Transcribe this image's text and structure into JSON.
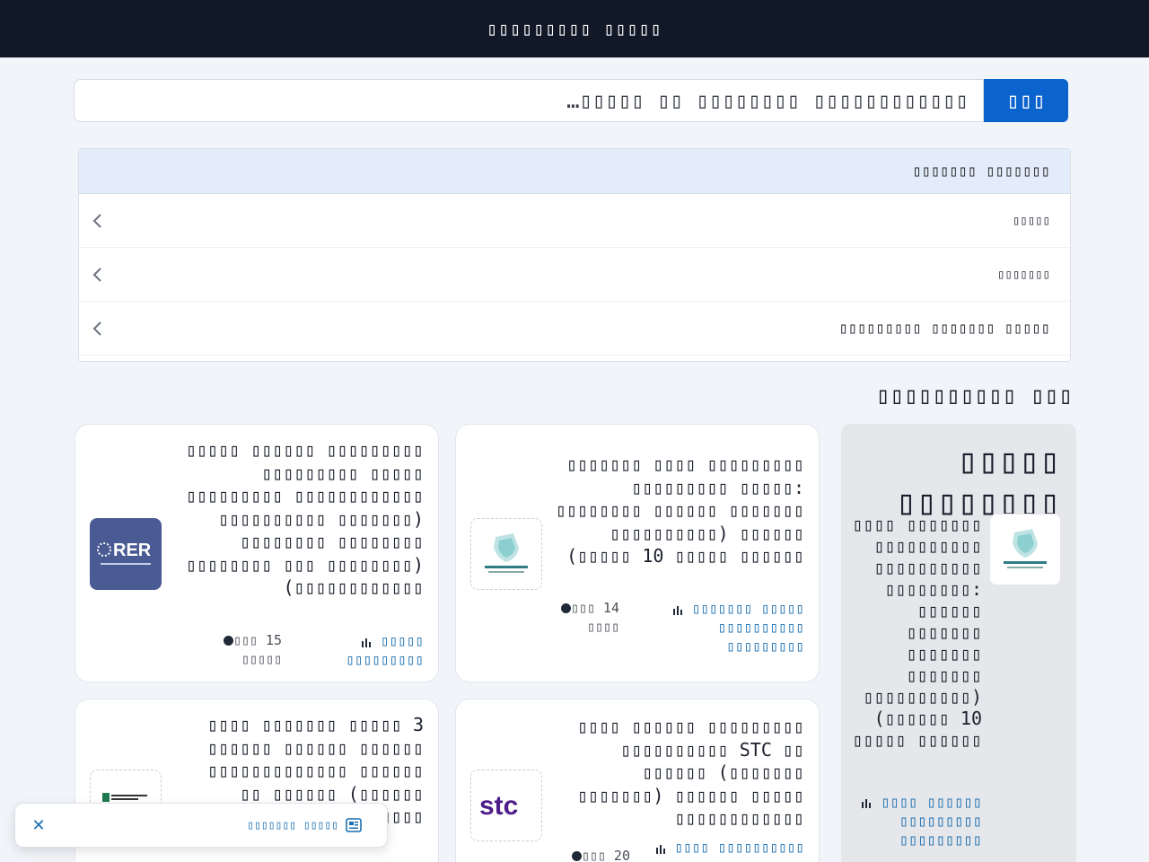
{
  "header": {
    "title": "▯▯▯▯▯▯▯▯▯ ▯▯▯▯▯"
  },
  "search": {
    "placeholder": "▯▯▯▯▯▯▯▯▯▯▯▯ ▯▯▯▯▯▯▯▯ ▯▯ ▯▯▯▯▯…",
    "button_label": "▯▯▯"
  },
  "categories": {
    "header": "▯▯▯▯▯▯▯ ▯▯▯▯▯▯▯",
    "items": [
      {
        "label": "▯▯▯▯▯"
      },
      {
        "label": "▯▯▯▯▯▯▯"
      },
      {
        "label": "▯▯▯▯▯▯▯▯▯ ▯▯▯▯▯▯▯ ▯▯▯▯▯"
      }
    ]
  },
  "section": {
    "title": "▯▯▯▯▯▯▯▯▯▯ ▯▯▯"
  },
  "sidebar": {
    "heading": "▯▯▯▯▯ ▯▯▯▯▯▯▯▯",
    "text": "▯▯▯▯ ▯▯▯▯▯▯▯ ▯▯▯▯▯▯▯▯▯▯ ▯▯▯▯▯▯▯▯▯▯ ▯▯▯▯▯▯▯▯: ▯▯▯▯▯▯ ▯▯▯▯▯▯▯ ▯▯▯▯▯▯▯ ▯▯▯▯▯▯▯ ▯▯▯▯▯▯▯▯▯▯) (▯▯▯▯▯▯ 10 ▯▯▯▯▯ ▯▯▯▯▯▯",
    "link": "▯▯▯▯ ▯▯▯▯▯▯ ▯▯▯▯▯▯▯▯▯ ▯▯▯▯▯▯▯▯▯"
  },
  "cards": [
    {
      "title": "▯▯▯▯▯▯▯ ▯▯▯▯ ▯▯▯▯▯▯▯▯▯ ▯▯▯▯▯▯▯▯▯ ▯▯▯▯▯: ▯▯▯▯▯▯▯▯ ▯▯▯▯▯▯ ▯▯▯▯▯▯▯ ▯▯▯▯▯▯▯▯▯▯) ▯▯▯▯▯▯ (▯▯▯▯▯ 10 ▯▯▯▯▯ ▯▯▯▯▯▯",
      "link": "▯▯▯▯▯▯▯ ▯▯▯▯▯ ▯▯▯▯▯▯▯▯▯▯ ▯▯▯▯▯▯▯▯▯",
      "meta": "▯▯▯ 14 ▯▯▯▯"
    },
    {
      "title": "▯▯▯▯▯ ▯▯▯▯▯▯ ▯▯▯▯▯▯▯▯▯ ▯▯▯▯▯▯▯▯▯ ▯▯▯▯▯ ▯▯▯▯▯▯▯▯▯ ▯▯▯▯▯▯▯▯▯▯▯▯ ▯▯▯▯▯▯▯▯▯▯ ▯▯▯▯▯▯▯) ▯▯▯▯▯▯▯▯ ▯▯▯▯▯▯▯▯ ▯▯▯▯▯▯▯▯ ▯▯▯ ▯▯▯▯▯▯▯▯) (▯▯▯▯▯▯▯▯▯▯▯▯",
      "link": "▯▯▯▯▯ ▯▯▯▯▯▯▯▯▯",
      "meta": "▯▯▯ 15 ▯▯▯▯▯"
    },
    {
      "title": "▯▯▯▯ ▯▯▯▯▯▯ ▯▯▯▯▯▯▯▯▯ ▯▯▯▯▯▯▯▯▯▯ STC ▯▯ ▯▯▯▯▯▯ (▯▯▯▯▯▯▯ ▯▯▯▯▯▯▯) ▯▯▯▯▯▯ ▯▯▯▯▯ ▯▯▯▯▯▯▯▯▯▯▯▯",
      "link": "▯▯▯▯ ▯▯▯▯▯▯▯▯▯▯",
      "meta": "▯▯▯ 20"
    },
    {
      "title": "▯▯▯▯ ▯▯▯▯▯▯▯ ▯▯▯▯▯ 3 ▯▯▯▯▯▯ ▯▯▯▯▯▯ ▯▯▯▯▯▯ ▯▯▯▯▯▯▯▯▯▯▯▯▯ ▯▯▯▯▯▯ ▯▯ ▯▯▯▯▯▯ (▯▯▯▯▯▯ ▯▯▯▯▯▯ ▯▯▯▯ ▯▯▯▯▯▯▯",
      "link": "▯▯▯▯▯",
      "meta": "▯▯▯"
    }
  ],
  "toast": {
    "text": "▯▯▯▯▯▯▯ ▯▯▯▯▯"
  }
}
